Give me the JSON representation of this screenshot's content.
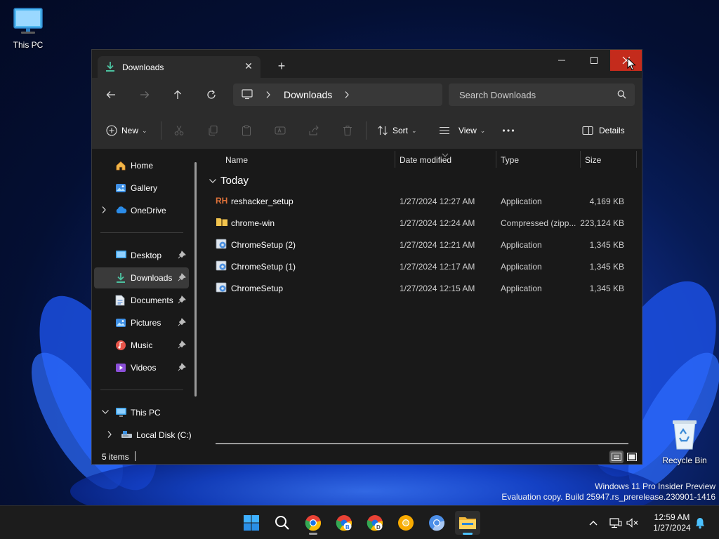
{
  "desktop": {
    "this_pc_label": "This PC",
    "recycle_bin_label": "Recycle Bin",
    "watermark_line1": "Windows 11 Pro Insider Preview",
    "watermark_line2": "Evaluation copy. Build 25947.rs_prerelease.230901-1416"
  },
  "window": {
    "tab_title": "Downloads",
    "tab_icon": "download-icon",
    "new_tab_symbol": "+",
    "close_tab_symbol": "✕",
    "close_button_color": "#c42b1c"
  },
  "navigation": {
    "breadcrumb": [
      "Downloads"
    ],
    "search_placeholder": "Search Downloads"
  },
  "toolbar": {
    "new_label": "New",
    "sort_label": "Sort",
    "view_label": "View",
    "details_label": "Details"
  },
  "sidebar": {
    "top": [
      {
        "label": "Home",
        "icon": "home-icon"
      },
      {
        "label": "Gallery",
        "icon": "gallery-icon"
      },
      {
        "label": "OneDrive",
        "icon": "cloud-icon"
      }
    ],
    "quick_access": [
      {
        "label": "Desktop",
        "icon": "desktop-icon",
        "pinned": true
      },
      {
        "label": "Downloads",
        "icon": "download-icon",
        "pinned": true,
        "selected": true
      },
      {
        "label": "Documents",
        "icon": "document-icon",
        "pinned": true
      },
      {
        "label": "Pictures",
        "icon": "pictures-icon",
        "pinned": true
      },
      {
        "label": "Music",
        "icon": "music-icon",
        "pinned": true
      },
      {
        "label": "Videos",
        "icon": "videos-icon",
        "pinned": true
      }
    ],
    "this_pc": "This PC",
    "local_disk": "Local Disk (C:)"
  },
  "files": {
    "columns": [
      "Name",
      "Date modified",
      "Type",
      "Size"
    ],
    "group": "Today",
    "rows": [
      {
        "name": "reshacker_setup",
        "date": "1/27/2024 12:27 AM",
        "type": "Application",
        "size": "4,169 KB",
        "icon": "reshacker-icon"
      },
      {
        "name": "chrome-win",
        "date": "1/27/2024 12:24 AM",
        "type": "Compressed (zipp...",
        "size": "223,124 KB",
        "icon": "zip-folder-icon"
      },
      {
        "name": "ChromeSetup (2)",
        "date": "1/27/2024 12:21 AM",
        "type": "Application",
        "size": "1,345 KB",
        "icon": "installer-icon"
      },
      {
        "name": "ChromeSetup (1)",
        "date": "1/27/2024 12:17 AM",
        "type": "Application",
        "size": "1,345 KB",
        "icon": "installer-icon"
      },
      {
        "name": "ChromeSetup",
        "date": "1/27/2024 12:15 AM",
        "type": "Application",
        "size": "1,345 KB",
        "icon": "installer-icon"
      }
    ]
  },
  "status": {
    "item_count": "5 items"
  },
  "taskbar": {
    "time": "12:59 AM",
    "date": "1/27/2024",
    "accent_color": "#4cc2ff",
    "apps": [
      "start-icon",
      "search-icon",
      "chrome-icon",
      "chrome-beta-icon",
      "chrome-dev-icon",
      "chrome-canary-icon",
      "chromium-icon",
      "file-explorer-icon"
    ]
  }
}
